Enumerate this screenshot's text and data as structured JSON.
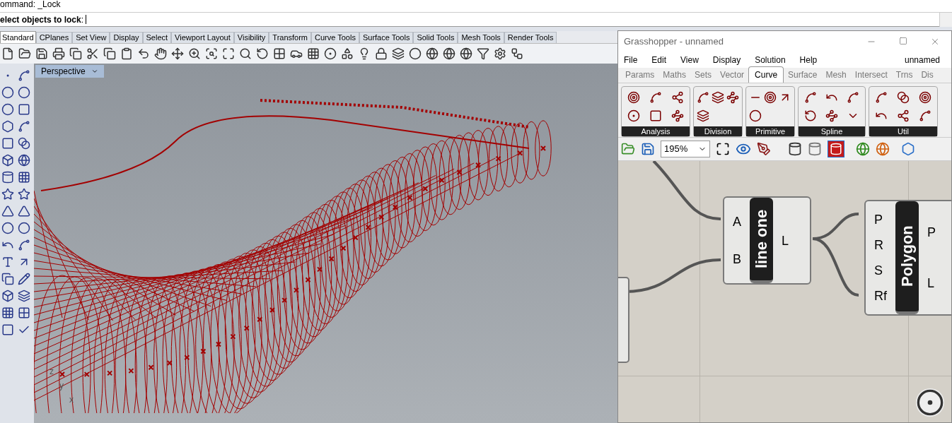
{
  "command_history": "ommand: _Lock",
  "command_prompt": "**elect objects to lock**:",
  "rhino_tabs": [
    {
      "label": "Standard",
      "selected": true
    },
    {
      "label": "CPlanes",
      "selected": false
    },
    {
      "label": "Set View",
      "selected": false
    },
    {
      "label": "Display",
      "selected": false
    },
    {
      "label": "Select",
      "selected": false
    },
    {
      "label": "Viewport Layout",
      "selected": false
    },
    {
      "label": "Visibility",
      "selected": false
    },
    {
      "label": "Transform",
      "selected": false
    },
    {
      "label": "Curve Tools",
      "selected": false
    },
    {
      "label": "Surface Tools",
      "selected": false
    },
    {
      "label": "Solid Tools",
      "selected": false
    },
    {
      "label": "Mesh Tools",
      "selected": false
    },
    {
      "label": "Render Tools",
      "selected": false
    }
  ],
  "viewport": {
    "title": "Perspective",
    "axes": [
      "z",
      "y",
      "x"
    ]
  },
  "grasshopper": {
    "title": "Grasshopper - unnamed",
    "menu": [
      "File",
      "Edit",
      "View",
      "Display",
      "Solution",
      "Help"
    ],
    "document": "unnamed",
    "tabs": [
      {
        "label": "Params",
        "selected": false
      },
      {
        "label": "Maths",
        "selected": false
      },
      {
        "label": "Sets",
        "selected": false
      },
      {
        "label": "Vector",
        "selected": false
      },
      {
        "label": "Curve",
        "selected": true
      },
      {
        "label": "Surface",
        "selected": false
      },
      {
        "label": "Mesh",
        "selected": false
      },
      {
        "label": "Intersect",
        "selected": false
      },
      {
        "label": "Trns",
        "selected": false
      },
      {
        "label": "Dis",
        "selected": false
      }
    ],
    "panels": [
      "Analysis",
      "Division",
      "Primitive",
      "Spline",
      "Util"
    ],
    "zoom": "195%",
    "components": [
      {
        "name": "line one",
        "inputs": [
          "A",
          "B"
        ],
        "outputs": [
          "L"
        ]
      },
      {
        "name": "Polygon",
        "inputs": [
          "P",
          "R",
          "S",
          "Rf"
        ],
        "outputs": [
          "P",
          "L"
        ]
      }
    ]
  }
}
